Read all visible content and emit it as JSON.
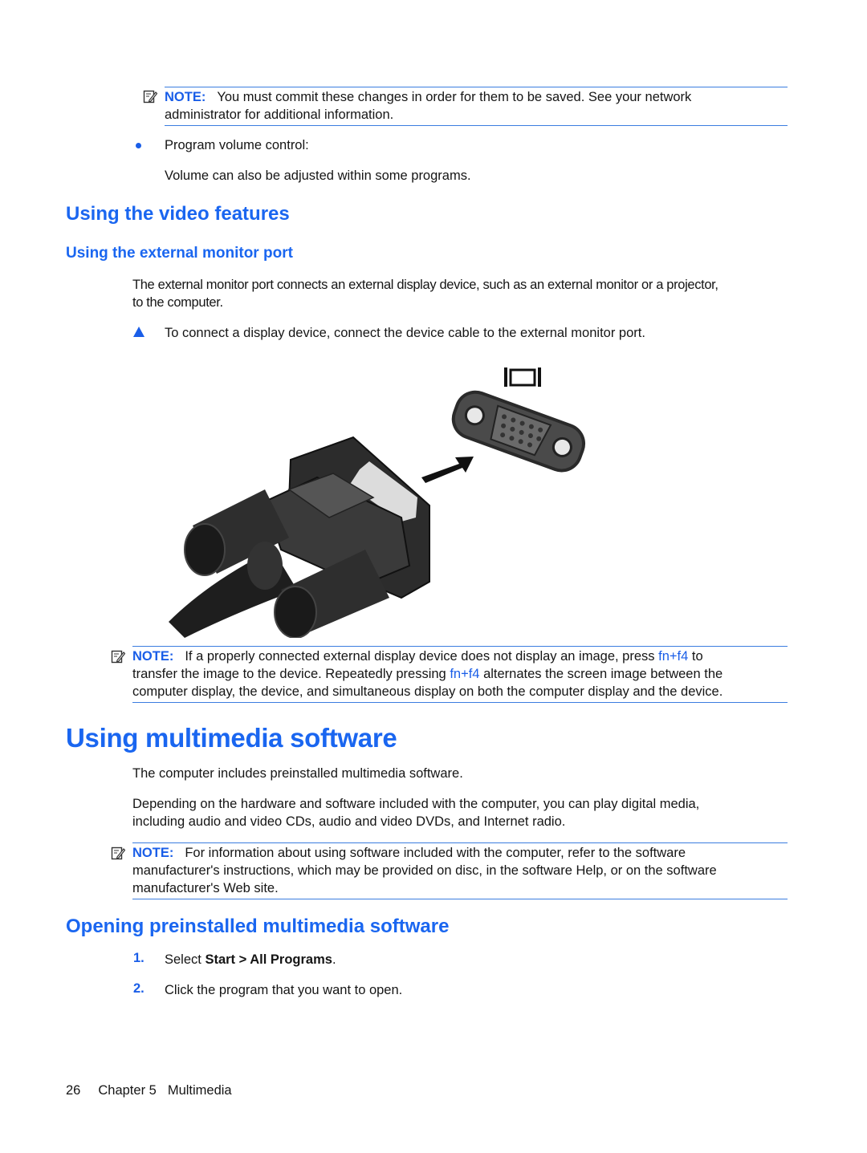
{
  "notes": {
    "label": "NOTE:",
    "note1": {
      "line1": "You must commit these changes in order for them to be saved. See your network",
      "line2": "administrator for additional information."
    },
    "note2": {
      "line1_pre": "If a properly connected external display device does not display an image, press ",
      "key1": "fn+f4",
      "line1_post": " to",
      "line2_pre": "transfer the image to the device. Repeatedly pressing ",
      "key2": "fn+f4",
      "line2_post": " alternates the screen image between the",
      "line3": "computer display, the device, and simultaneous display on both the computer display and the device."
    },
    "note3": {
      "line1": "For information about using software included with the computer, refer to the software",
      "line2": "manufacturer's instructions, which may be provided on disc, in the software Help, or on the software",
      "line3": "manufacturer's Web site."
    }
  },
  "bullet": {
    "title": "Program volume control:",
    "text": "Volume can also be adjusted within some programs."
  },
  "video_section": {
    "heading": "Using the video features",
    "subheading": "Using the external monitor port",
    "para_line1": "The external monitor port connects an external display device, such as an external monitor or a projector,",
    "para_line2": "to the computer.",
    "instruction": "To connect a display device, connect the device cable to the external monitor port.",
    "figure": {
      "port_symbol": "external-monitor-port-symbol",
      "description": "VGA cable connector being plugged into external monitor port"
    }
  },
  "multimedia_section": {
    "heading": "Using multimedia software",
    "para1": "The computer includes preinstalled multimedia software.",
    "para2_line1": "Depending on the hardware and software included with the computer, you can play digital media,",
    "para2_line2": "including audio and video CDs, audio and video DVDs, and Internet radio."
  },
  "opening_section": {
    "heading": "Opening preinstalled multimedia software",
    "steps": [
      {
        "num": "1.",
        "pre": "Select ",
        "bold": "Start > All Programs",
        "post": "."
      },
      {
        "num": "2.",
        "text": "Click the program that you want to open."
      }
    ]
  },
  "footer": {
    "page_number": "26",
    "chapter": "Chapter 5",
    "chapter_title": "Multimedia"
  },
  "colors": {
    "heading_blue": "#1a66f0",
    "accent_blue": "#1a5ee8",
    "rule_blue": "#3b7de0"
  }
}
